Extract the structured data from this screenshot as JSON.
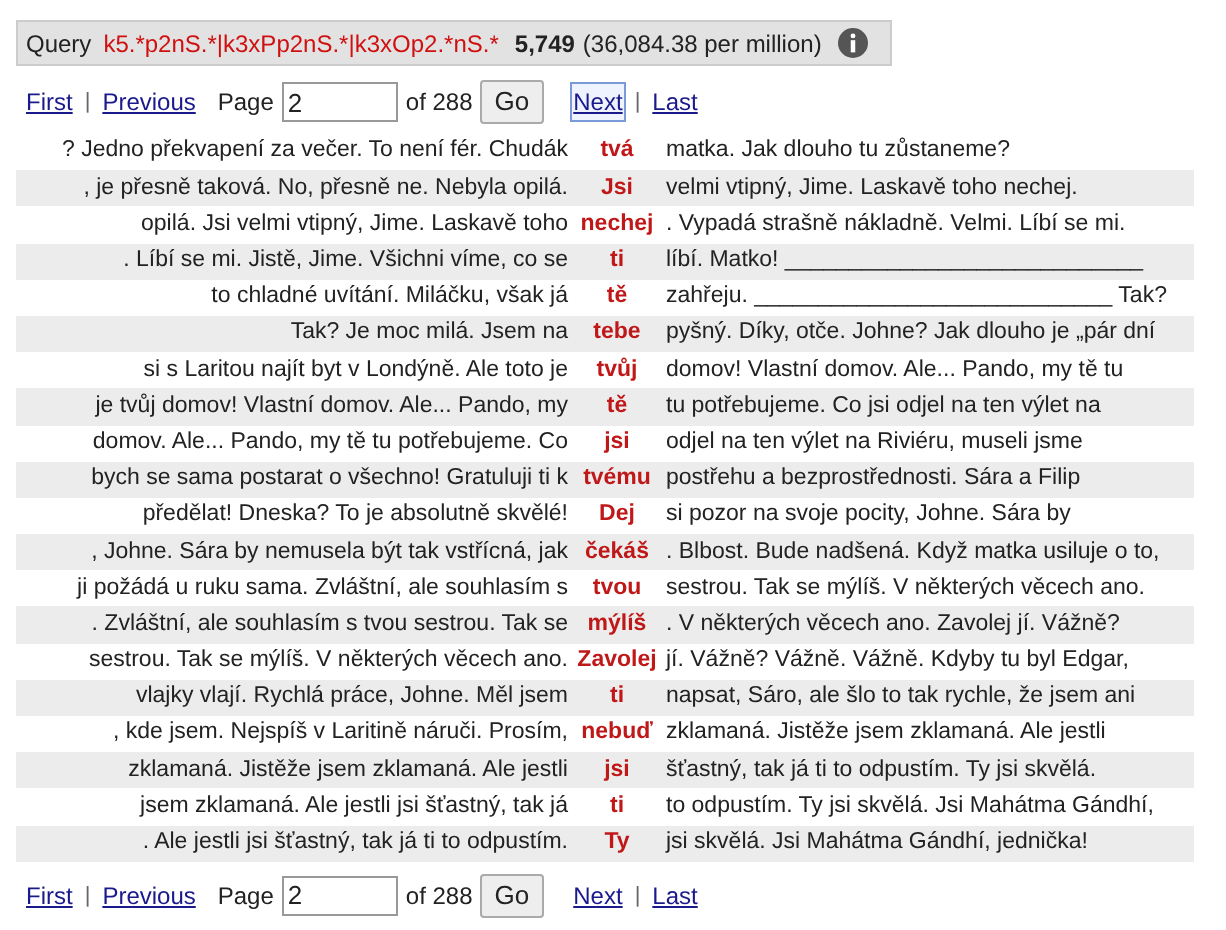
{
  "query": {
    "label": "Query",
    "pattern": "k5.*p2nS.*|k3xPp2nS.*|k3xOp2.*nS.*",
    "count": "5,749",
    "frequency": "(36,084.38 per million)"
  },
  "pagers": [
    {
      "links_before": [
        {
          "label": "First",
          "focused": false
        },
        {
          "label": "Previous",
          "focused": false
        }
      ],
      "page_label": "Page",
      "page_value": "2",
      "of_label": "of 288",
      "go": "Go",
      "links_after": [
        {
          "label": "Next",
          "focused": true
        },
        {
          "label": "Last",
          "focused": false
        }
      ],
      "separator": "|"
    },
    {
      "links_before": [
        {
          "label": "First",
          "focused": false
        },
        {
          "label": "Previous",
          "focused": false
        }
      ],
      "page_label": "Page",
      "page_value": "2",
      "of_label": "of 288",
      "go": "Go",
      "links_after": [
        {
          "label": "Next",
          "focused": false
        },
        {
          "label": "Last",
          "focused": false
        }
      ],
      "separator": "|"
    }
  ],
  "rows": [
    {
      "left": "? Jedno překvapení za večer. To není fér. Chudák",
      "kwic": "tvá",
      "right": "matka. Jak dlouho tu zůstaneme?"
    },
    {
      "left": ", je přesně taková. No, přesně ne. Nebyla opilá.",
      "kwic": "Jsi",
      "right": "velmi vtipný, Jime. Laskavě toho nechej."
    },
    {
      "left": "opilá. Jsi velmi vtipný, Jime. Laskavě toho",
      "kwic": "nechej",
      "right": ". Vypadá strašně nákladně. Velmi. Líbí se mi."
    },
    {
      "left": ". Líbí se mi. Jistě, Jime. Všichni víme, co se",
      "kwic": "ti",
      "right": "líbí. Matko! ____________________________"
    },
    {
      "left": "to chladné uvítání. Miláčku, však já",
      "kwic": "tě",
      "right": "zahřeju. ____________________________ Tak?"
    },
    {
      "left": "Tak? Je moc milá. Jsem na",
      "kwic": "tebe",
      "right": "pyšný. Díky, otče. Johne? Jak dlouho je „pár dní"
    },
    {
      "left": "si s Laritou najít byt v Londýně. Ale toto je",
      "kwic": "tvůj",
      "right": "domov! Vlastní domov. Ale... Pando, my tě tu"
    },
    {
      "left": "je tvůj domov! Vlastní domov. Ale... Pando, my",
      "kwic": "tě",
      "right": "tu potřebujeme. Co jsi odjel na ten výlet na"
    },
    {
      "left": "domov. Ale... Pando, my tě tu potřebujeme. Co",
      "kwic": "jsi",
      "right": "odjel na ten výlet na Riviéru, museli jsme"
    },
    {
      "left": "bych se sama postarat o všechno! Gratuluji ti k",
      "kwic": "tvému",
      "right": "postřehu a bezprostřednosti. Sára a Filip"
    },
    {
      "left": "předělat! Dneska? To je absolutně skvělé!",
      "kwic": "Dej",
      "right": "si pozor na svoje pocity, Johne. Sára by"
    },
    {
      "left": ", Johne. Sára by nemusela být tak vstřícná, jak",
      "kwic": "čekáš",
      "right": ". Blbost. Bude nadšená. Když matka usiluje o to,"
    },
    {
      "left": "ji požádá u ruku sama. Zvláštní, ale souhlasím s",
      "kwic": "tvou",
      "right": "sestrou. Tak se mýlíš. V některých věcech ano."
    },
    {
      "left": ". Zvláštní, ale souhlasím s tvou sestrou. Tak se",
      "kwic": "mýlíš",
      "right": ". V některých věcech ano. Zavolej jí. Vážně?"
    },
    {
      "left": "sestrou. Tak se mýlíš. V některých věcech ano.",
      "kwic": "Zavolej",
      "right": "jí. Vážně? Vážně. Vážně. Kdyby tu byl Edgar,"
    },
    {
      "left": "vlajky vlají. Rychlá práce, Johne. Měl jsem",
      "kwic": "ti",
      "right": "napsat, Sáro, ale šlo to tak rychle, že jsem ani"
    },
    {
      "left": ", kde jsem. Nejspíš v Laritině náruči. Prosím,",
      "kwic": "nebuď",
      "right": "zklamaná. Jistěže jsem zklamaná. Ale jestli"
    },
    {
      "left": "zklamaná. Jistěže jsem zklamaná. Ale jestli",
      "kwic": "jsi",
      "right": "šťastný, tak já ti to odpustím. Ty jsi skvělá."
    },
    {
      "left": "jsem zklamaná. Ale jestli jsi šťastný, tak já",
      "kwic": "ti",
      "right": "to odpustím. Ty jsi skvělá. Jsi Mahátma Gándhí,"
    },
    {
      "left": ". Ale jestli jsi šťastný, tak já ti to odpustím.",
      "kwic": "Ty",
      "right": "jsi skvělá. Jsi Mahátma Gándhí, jednička!"
    }
  ]
}
